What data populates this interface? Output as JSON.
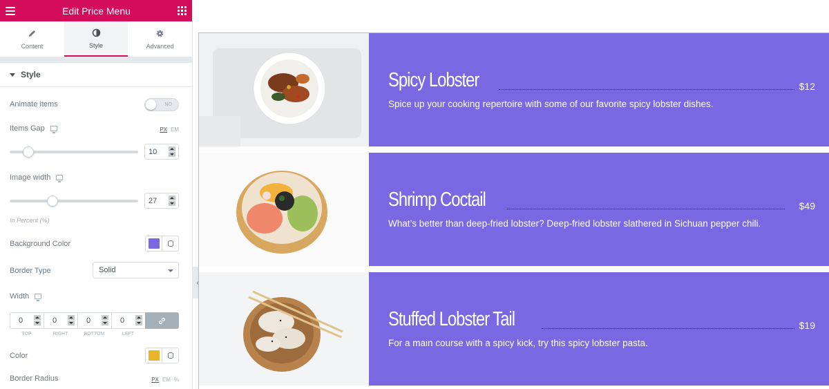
{
  "panel": {
    "title": "Edit Price Menu",
    "tabs": [
      {
        "label": "Content",
        "icon": "pencil-icon"
      },
      {
        "label": "Style",
        "icon": "half-circle-icon",
        "active": true
      },
      {
        "label": "Advanced",
        "icon": "gear-icon"
      }
    ],
    "section_title": "Style",
    "animate_items": {
      "label": "Animate items",
      "toggle_text": "NO"
    },
    "items_gap": {
      "label": "Items Gap",
      "units": [
        "PX",
        "EM"
      ],
      "value": "10",
      "slider_fraction": 0.1
    },
    "image_width": {
      "label": "Image width",
      "value": "27",
      "slider_fraction": 0.27,
      "hint": "In Percent (%)"
    },
    "background_color": {
      "label": "Background Color",
      "color": "#7968e2"
    },
    "border_type": {
      "label": "Border Type",
      "value": "Solid"
    },
    "width": {
      "label": "Width",
      "values": [
        "0",
        "0",
        "0",
        "0"
      ],
      "sides": [
        "TOP",
        "RIGHT",
        "BOTTOM",
        "LEFT"
      ]
    },
    "color": {
      "label": "Color",
      "color": "#e8b52a"
    },
    "border_radius": {
      "label": "Border Radius",
      "units": [
        "PX",
        "EM",
        "%"
      ]
    }
  },
  "menu": {
    "items": [
      {
        "name": "Spicy Lobster",
        "price": "$12",
        "description": "Spice up your cooking repertoire with some of our favorite spicy lobster dishes.",
        "image": "bowl-of-roasted-potatoes-image"
      },
      {
        "name": "Shrimp Coctail",
        "price": "$49",
        "description": "What’s better than deep-fried lobster? Deep-fried lobster slathered in Sichuan pepper chili.",
        "image": "poke-bowl-image"
      },
      {
        "name": "Stuffed Lobster Tail",
        "price": "$19",
        "description": "For a main course with a spicy kick, try this spicy lobster pasta.",
        "image": "dumplings-with-chopsticks-image"
      }
    ]
  }
}
